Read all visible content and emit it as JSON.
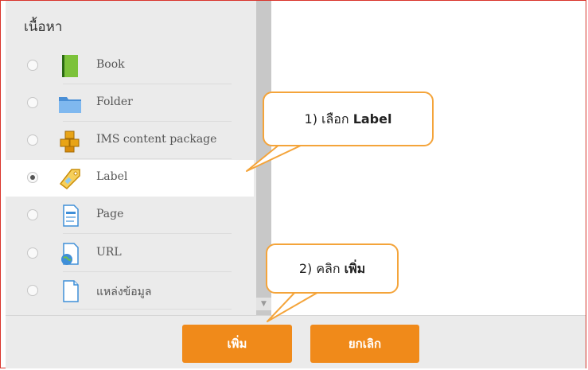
{
  "section": {
    "title": "เนื้อหา"
  },
  "items": [
    {
      "label": "Book",
      "icon": "book-icon",
      "selected": false
    },
    {
      "label": "Folder",
      "icon": "folder-icon",
      "selected": false
    },
    {
      "label": "IMS content package",
      "icon": "ims-package-icon",
      "selected": false
    },
    {
      "label": "Label",
      "icon": "label-tag-icon",
      "selected": true
    },
    {
      "label": "Page",
      "icon": "page-icon",
      "selected": false
    },
    {
      "label": "URL",
      "icon": "url-icon",
      "selected": false
    },
    {
      "label": "แหล่งข้อมูล",
      "icon": "file-icon",
      "selected": false
    }
  ],
  "buttons": {
    "add": "เพิ่ม",
    "cancel": "ยกเลิก"
  },
  "callouts": {
    "step1": {
      "prefix": "1) เลือก ",
      "strong": "Label"
    },
    "step2": {
      "prefix": "2) คลิก ",
      "strong": "เพิ่ม"
    }
  },
  "colors": {
    "accent": "#f08a1a",
    "callout_border": "#f4a43a",
    "frame_border": "#d9342b"
  }
}
